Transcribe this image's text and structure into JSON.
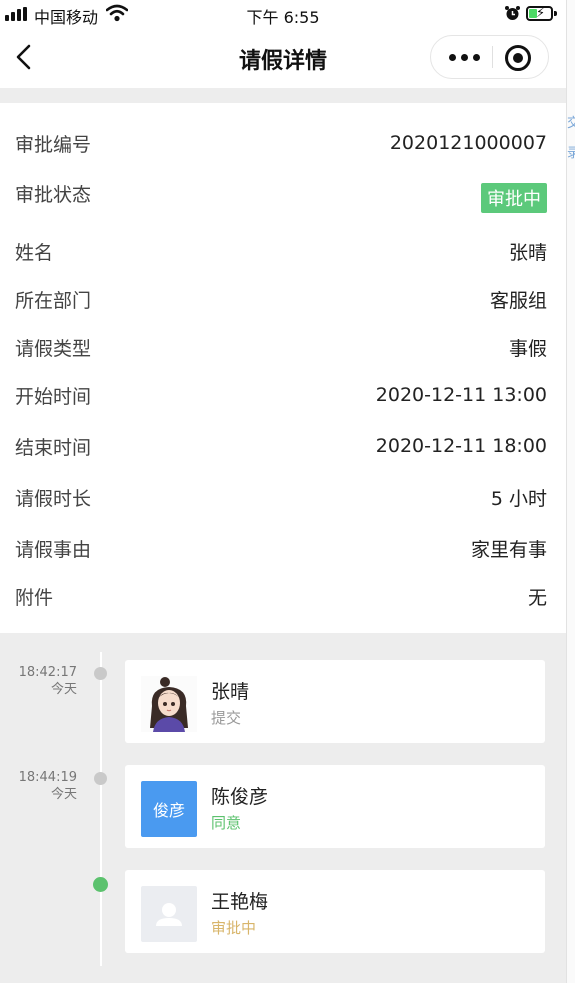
{
  "status_bar": {
    "carrier": "中国移动",
    "time": "下午 6:55"
  },
  "nav": {
    "title": "请假详情",
    "back_icon": "chevron-left-icon",
    "more_icon": "more-dots-icon",
    "close_icon": "target-icon"
  },
  "details": [
    {
      "label": "审批编号",
      "value": "2020121000007"
    },
    {
      "label": "审批状态",
      "value": "审批中",
      "badge": true,
      "color": "#5cc97b"
    },
    {
      "label": "姓名",
      "value": "张晴"
    },
    {
      "label": "所在部门",
      "value": "客服组"
    },
    {
      "label": "请假类型",
      "value": "事假"
    },
    {
      "label": "开始时间",
      "value": "2020-12-11 13:00"
    },
    {
      "label": "结束时间",
      "value": "2020-12-11 18:00"
    },
    {
      "label": "请假时长",
      "value": "5 小时"
    },
    {
      "label": "请假事由",
      "value": "家里有事"
    },
    {
      "label": "附件",
      "value": "无"
    }
  ],
  "timeline": [
    {
      "time": "18:42:17",
      "day": "今天",
      "name": "张晴",
      "status": "提交",
      "status_color": "#999999",
      "avatar": "illustrated-girl-avatar"
    },
    {
      "time": "18:44:19",
      "day": "今天",
      "name": "陈俊彦",
      "status": "同意",
      "status_color": "#5cc26e",
      "avatar_text": "俊彦",
      "avatar_color": "#4a9af0"
    },
    {
      "time": "",
      "day": "",
      "name": "王艳梅",
      "status": "审批中",
      "status_color": "#d8b56a",
      "avatar": "default-user-avatar"
    }
  ],
  "edge_chars": [
    "交",
    "录"
  ]
}
